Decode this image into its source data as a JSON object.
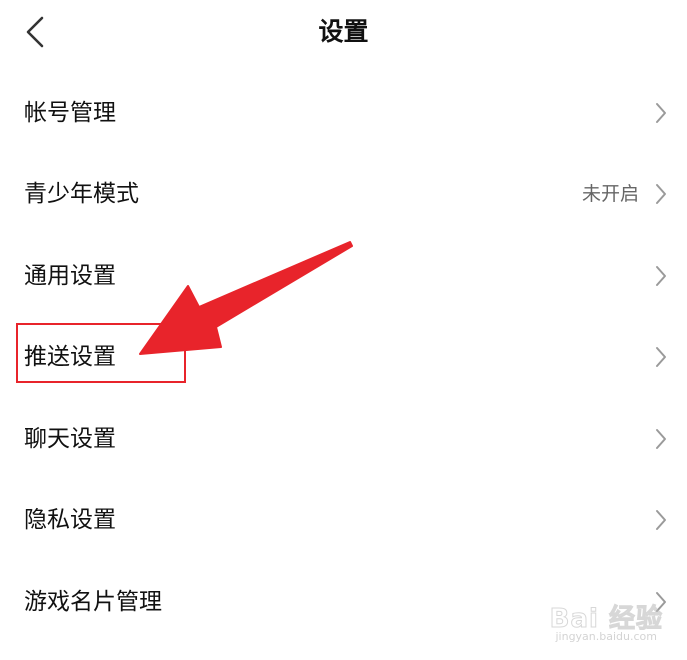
{
  "header": {
    "title": "设置",
    "back_icon": "chevron-left-icon"
  },
  "settings_list": [
    {
      "label": "帐号管理",
      "value": ""
    },
    {
      "label": "青少年模式",
      "value": "未开启"
    },
    {
      "label": "通用设置",
      "value": ""
    },
    {
      "label": "推送设置",
      "value": ""
    },
    {
      "label": "聊天设置",
      "value": ""
    },
    {
      "label": "隐私设置",
      "value": ""
    },
    {
      "label": "游戏名片管理",
      "value": ""
    }
  ],
  "annotation": {
    "highlight_color": "#e8242b",
    "arrow_color": "#e8242b",
    "highlighted_item": "推送设置"
  },
  "watermark": {
    "brand": "Bai 经验",
    "url": "jingyan.baidu.com"
  },
  "colors": {
    "background": "#ffffff",
    "text": "#111111",
    "secondary_text": "#666666",
    "chevron": "#9a9a9a"
  }
}
